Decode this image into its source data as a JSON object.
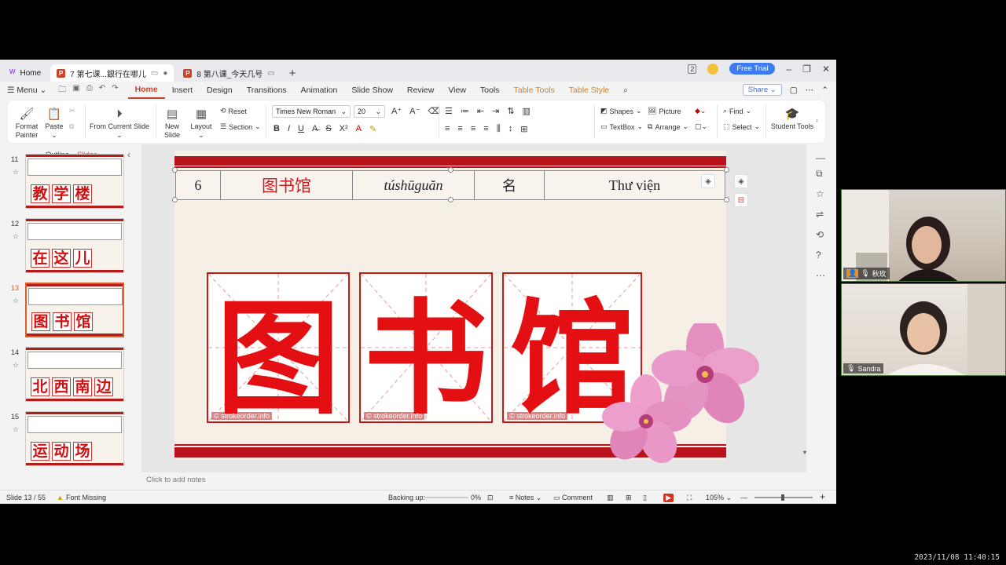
{
  "tabs": [
    {
      "label": "Home",
      "icon": "wps-home-icon"
    },
    {
      "label": "7 第七课...銀行在哪儿",
      "icon": "presentation-file-icon",
      "active": true
    },
    {
      "label": "8 第八课_今天几号",
      "icon": "presentation-file-icon"
    }
  ],
  "titlebar": {
    "free_trial": "Free Trial",
    "badge": "2"
  },
  "menu": {
    "menu_label": "Menu",
    "items": [
      "Home",
      "Insert",
      "Design",
      "Transitions",
      "Animation",
      "Slide Show",
      "Review",
      "View",
      "Tools",
      "Table Tools",
      "Table Style"
    ],
    "active": "Home",
    "share": "Share"
  },
  "ribbon": {
    "format_painter": "Format Painter",
    "paste": "Paste",
    "from_current_slide": "From Current Slide",
    "new_slide": "New Slide",
    "layout": "Layout",
    "reset": "Reset",
    "section": "Section",
    "font_name": "Times New Roman",
    "font_size": "20",
    "shapes": "Shapes",
    "picture": "Picture",
    "textbox": "TextBox",
    "arrange": "Arrange",
    "find": "Find",
    "select": "Select",
    "student_tools": "Student Tools"
  },
  "leftpanel": {
    "outline_tab": "Outline",
    "slides_tab": "Slides",
    "thumbs": [
      {
        "num": "11",
        "chars": [
          "教",
          "学",
          "楼"
        ]
      },
      {
        "num": "12",
        "chars": [
          "在",
          "这",
          "儿"
        ]
      },
      {
        "num": "13",
        "chars": [
          "图",
          "书",
          "馆"
        ],
        "selected": true
      },
      {
        "num": "14",
        "chars": [
          "北",
          "西",
          "南",
          "边"
        ]
      },
      {
        "num": "15",
        "chars": [
          "运",
          "动",
          "场"
        ]
      }
    ]
  },
  "slide": {
    "table_row": {
      "stt": "6",
      "word": "图书馆",
      "pinyin": "túshūguăn",
      "pos": "名",
      "meaning": "Thư viện"
    },
    "chars": [
      "图",
      "书",
      "馆"
    ],
    "watermark": "© strokeorder.info"
  },
  "notes_placeholder": "Click to add notes",
  "status": {
    "slide_counter": "Slide 13 / 55",
    "font_missing": "Font Missing",
    "backing_up": "Backing up:",
    "backup_percent": "0%",
    "notes": "Notes",
    "comment": "Comment",
    "zoom": "105%"
  },
  "participants": [
    {
      "name": "秋玫"
    },
    {
      "name": "Sandra"
    }
  ],
  "timestamp": "2023/11/08 11:40:15",
  "colors": {
    "accent": "#c6452c",
    "slide_red": "#b8121b",
    "char_red": "#e30f12"
  }
}
